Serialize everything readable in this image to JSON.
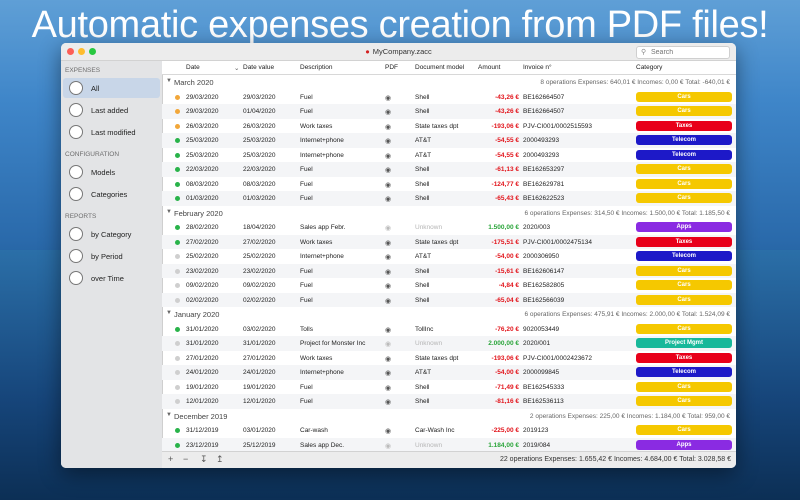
{
  "headline": "Automatic expenses creation from PDF files!",
  "window": {
    "title": "MyCompany.zacc"
  },
  "search": {
    "placeholder": "Search"
  },
  "sidebar": {
    "sections": [
      {
        "label": "EXPENSES"
      },
      {
        "label": "CONFIGURATION"
      },
      {
        "label": "REPORTS"
      }
    ],
    "items": [
      {
        "label": "All",
        "icon": "piggy-bank-icon"
      },
      {
        "label": "Last added",
        "icon": "clock-plus-icon"
      },
      {
        "label": "Last modified",
        "icon": "clock-edit-icon"
      },
      {
        "label": "Models",
        "icon": "gear-icon"
      },
      {
        "label": "Categories",
        "icon": "tag-icon"
      },
      {
        "label": "by Category",
        "icon": "pie-chart-icon"
      },
      {
        "label": "by Period",
        "icon": "bar-chart-icon"
      },
      {
        "label": "over Time",
        "icon": "line-chart-icon"
      }
    ]
  },
  "columns": [
    "Date",
    "Date value",
    "Description",
    "PDF",
    "Document model",
    "Amount",
    "Invoice n°",
    "Category"
  ],
  "colors": {
    "Cars": "#f5c800",
    "Taxes": "#e8001a",
    "Telecom": "#1d19c8",
    "Apps": "#8a2be2",
    "Project Mgmt": "#18b89a"
  },
  "groups": [
    {
      "title": "March 2020",
      "summary": "8 operations    Expenses: 640,01 €    Incomes: 0,00 €    Total: -640,01 €",
      "rows": [
        {
          "status": "#f2a73a",
          "date": "29/03/2020",
          "date_value": "29/03/2020",
          "desc": "Fuel",
          "model": "Shell",
          "amount": "-43,26 €",
          "invoice": "BE162664507",
          "category": "Cars"
        },
        {
          "status": "#f2a73a",
          "date": "29/03/2020",
          "date_value": "01/04/2020",
          "desc": "Fuel",
          "model": "Shell",
          "amount": "-43,26 €",
          "invoice": "BE162664507",
          "category": "Cars"
        },
        {
          "status": "#f2a73a",
          "date": "26/03/2020",
          "date_value": "26/03/2020",
          "desc": "Work taxes",
          "model": "State taxes dpt",
          "amount": "-193,06 €",
          "invoice": "PJV-CI001/0002515593",
          "category": "Taxes"
        },
        {
          "status": "#29b34a",
          "date": "25/03/2020",
          "date_value": "25/03/2020",
          "desc": "Internet+phone",
          "model": "AT&T",
          "amount": "-54,55 €",
          "invoice": "2000493293",
          "category": "Telecom"
        },
        {
          "status": "#29b34a",
          "date": "25/03/2020",
          "date_value": "25/03/2020",
          "desc": "Internet+phone",
          "model": "AT&T",
          "amount": "-54,55 €",
          "invoice": "2000493293",
          "category": "Telecom"
        },
        {
          "status": "#29b34a",
          "date": "22/03/2020",
          "date_value": "22/03/2020",
          "desc": "Fuel",
          "model": "Shell",
          "amount": "-61,13 €",
          "invoice": "BE162653297",
          "category": "Cars"
        },
        {
          "status": "#29b34a",
          "date": "08/03/2020",
          "date_value": "08/03/2020",
          "desc": "Fuel",
          "model": "Shell",
          "amount": "-124,77 €",
          "invoice": "BE162629781",
          "category": "Cars"
        },
        {
          "status": "#29b34a",
          "date": "01/03/2020",
          "date_value": "01/03/2020",
          "desc": "Fuel",
          "model": "Shell",
          "amount": "-65,43 €",
          "invoice": "BE162622523",
          "category": "Cars"
        }
      ]
    },
    {
      "title": "February 2020",
      "summary": "6 operations    Expenses: 314,50 €    Incomes: 1.500,00 €    Total: 1.185,50 €",
      "rows": [
        {
          "status": "#29b34a",
          "date": "28/02/2020",
          "date_value": "18/04/2020",
          "desc": "Sales app Febr.",
          "model": "Unknown",
          "amount": "1.500,00 €",
          "invoice": "2020/003",
          "category": "Apps",
          "income": true
        },
        {
          "status": "#29b34a",
          "date": "27/02/2020",
          "date_value": "27/02/2020",
          "desc": "Work taxes",
          "model": "State taxes dpt",
          "amount": "-175,51 €",
          "invoice": "PJV-CI001/0002475134",
          "category": "Taxes"
        },
        {
          "status": "#cfcfcf",
          "date": "25/02/2020",
          "date_value": "25/02/2020",
          "desc": "Internet+phone",
          "model": "AT&T",
          "amount": "-54,00 €",
          "invoice": "2000306950",
          "category": "Telecom"
        },
        {
          "status": "#cfcfcf",
          "date": "23/02/2020",
          "date_value": "23/02/2020",
          "desc": "Fuel",
          "model": "Shell",
          "amount": "-15,61 €",
          "invoice": "BE162606147",
          "category": "Cars"
        },
        {
          "status": "#cfcfcf",
          "date": "09/02/2020",
          "date_value": "09/02/2020",
          "desc": "Fuel",
          "model": "Shell",
          "amount": "-4,84 €",
          "invoice": "BE162582805",
          "category": "Cars"
        },
        {
          "status": "#cfcfcf",
          "date": "02/02/2020",
          "date_value": "02/02/2020",
          "desc": "Fuel",
          "model": "Shell",
          "amount": "-65,04 €",
          "invoice": "BE162566039",
          "category": "Cars"
        }
      ]
    },
    {
      "title": "January 2020",
      "summary": "6 operations    Expenses: 475,91 €    Incomes: 2.000,00 €    Total: 1.524,09 €",
      "rows": [
        {
          "status": "#29b34a",
          "date": "31/01/2020",
          "date_value": "03/02/2020",
          "desc": "Tolls",
          "model": "TollInc",
          "amount": "-76,20 €",
          "invoice": "9020053449",
          "category": "Cars"
        },
        {
          "status": "#cfcfcf",
          "date": "31/01/2020",
          "date_value": "31/01/2020",
          "desc": "Project for Monster Inc",
          "model": "Unknown",
          "amount": "2.000,00 €",
          "invoice": "2020/001",
          "category": "Project Mgmt",
          "income": true
        },
        {
          "status": "#cfcfcf",
          "date": "27/01/2020",
          "date_value": "27/01/2020",
          "desc": "Work taxes",
          "model": "State taxes dpt",
          "amount": "-193,06 €",
          "invoice": "PJV-CI001/0002423672",
          "category": "Taxes"
        },
        {
          "status": "#cfcfcf",
          "date": "24/01/2020",
          "date_value": "24/01/2020",
          "desc": "Internet+phone",
          "model": "AT&T",
          "amount": "-54,00 €",
          "invoice": "2000099845",
          "category": "Telecom"
        },
        {
          "status": "#cfcfcf",
          "date": "19/01/2020",
          "date_value": "19/01/2020",
          "desc": "Fuel",
          "model": "Shell",
          "amount": "-71,49 €",
          "invoice": "BE162545333",
          "category": "Cars"
        },
        {
          "status": "#cfcfcf",
          "date": "12/01/2020",
          "date_value": "12/01/2020",
          "desc": "Fuel",
          "model": "Shell",
          "amount": "-81,16 €",
          "invoice": "BE162536113",
          "category": "Cars"
        }
      ]
    },
    {
      "title": "December 2019",
      "summary": "2 operations    Expenses: 225,00 €    Incomes: 1.184,00 €    Total: 959,00 €",
      "rows": [
        {
          "status": "#29b34a",
          "date": "31/12/2019",
          "date_value": "03/01/2020",
          "desc": "Car-wash",
          "model": "Car-Wash Inc",
          "amount": "-225,00 €",
          "invoice": "2019123",
          "category": "Cars"
        },
        {
          "status": "#29b34a",
          "date": "23/12/2019",
          "date_value": "25/12/2019",
          "desc": "Sales app Dec.",
          "model": "Unknown",
          "amount": "1.184,00 €",
          "invoice": "2019/084",
          "category": "Apps",
          "income": true
        }
      ]
    }
  ],
  "footer": {
    "totals": "22 operations    Expenses: 1.655,42 €    Incomes: 4.684,00 €    Total: 3.028,58 €"
  }
}
